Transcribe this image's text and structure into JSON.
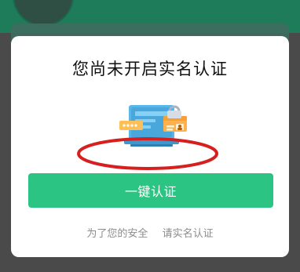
{
  "dialog": {
    "title": "您尚未开启实名认证",
    "primary_button_label": "一键认证",
    "hint_part_1": "为了您的安全",
    "hint_part_2": "请实名认证"
  },
  "colors": {
    "primary_button": "#2cc482",
    "annotation": "#d62020",
    "hint_text": "#8c8c8c",
    "backdrop": "#4a4a4a"
  },
  "icons": {
    "illustration": "id-card-laptop-illustration"
  }
}
